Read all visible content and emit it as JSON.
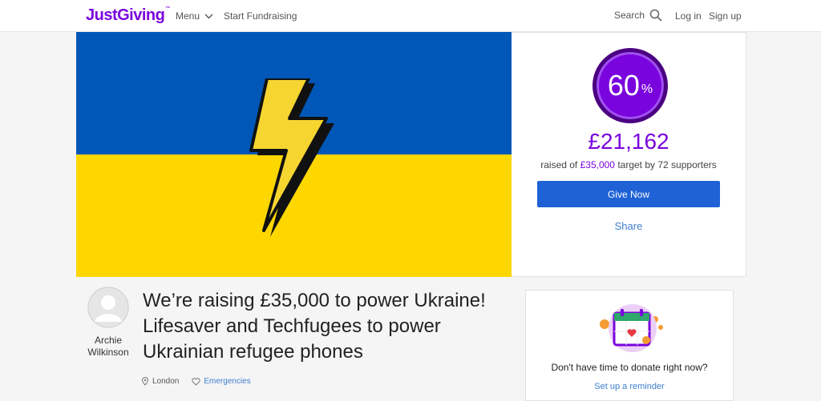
{
  "header": {
    "logo": "JustGiving",
    "logo_tm": "™",
    "menu_label": "Menu",
    "start_fundraising": "Start Fundraising",
    "search_label": "Search",
    "login": "Log in",
    "signup": "Sign up"
  },
  "donation": {
    "percent": "60",
    "percent_symbol": "%",
    "progress_fraction": 0.6,
    "amount_raised": "£21,162",
    "raised_prefix": "raised of ",
    "target": "£35,000",
    "target_mid": " target by ",
    "supporters": "72 supporters",
    "give_button": "Give Now",
    "share": "Share"
  },
  "organiser": {
    "name": "Archie Wilkinson"
  },
  "page": {
    "title": "We’re raising £35,000 to power Ukraine! Lifesaver and Techfugees to power Ukrainian refugee phones",
    "location": "London",
    "category": "Emergencies"
  },
  "reminder": {
    "text": "Don't have time to donate right now?",
    "link": "Set up a reminder"
  },
  "colors": {
    "brand": "#7a04dd",
    "button": "#1e62d6",
    "link": "#3f7fd0",
    "flag_blue": "#0057b7",
    "flag_yellow": "#ffd700"
  }
}
